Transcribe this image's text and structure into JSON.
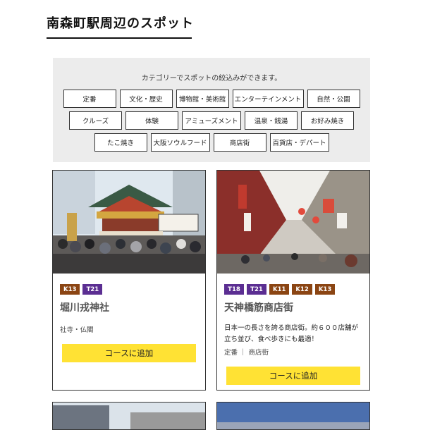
{
  "page": {
    "title": "南森町駅周辺のスポット"
  },
  "filter": {
    "caption": "カテゴリーでスポットの絞込みができます。",
    "row1": [
      "定番",
      "文化・歴史",
      "博物館・美術館",
      "エンターテインメント",
      "自然・公園"
    ],
    "row2": [
      "クルーズ",
      "体験",
      "アミューズメント",
      "温泉・銭湯",
      "お好み焼き"
    ],
    "row3": [
      "たこ焼き",
      "大阪ソウルフード",
      "商店街",
      "百貨店・デパート"
    ]
  },
  "cards": [
    {
      "tags": [
        {
          "label": "K13",
          "color": "#8b4513"
        },
        {
          "label": "T21",
          "color": "#5b2e92"
        }
      ],
      "name": "堀川戎神社",
      "category": "社寺・仏閣",
      "button": "コースに追加"
    },
    {
      "tags": [
        {
          "label": "T18",
          "color": "#5b2e92"
        },
        {
          "label": "T21",
          "color": "#5b2e92"
        },
        {
          "label": "K11",
          "color": "#8b4513"
        },
        {
          "label": "K12",
          "color": "#8b4513"
        },
        {
          "label": "K13",
          "color": "#8b4513"
        }
      ],
      "name": "天神橋筋商店街",
      "description": "日本一の長さを誇る商店街。約６００店舗が立ち並び、食べ歩きにも最適！",
      "category": "定番 ｜ 商店街",
      "button": "コースに追加"
    }
  ],
  "colors": {
    "button": "#ffe234",
    "tag_purple": "#5b2e92",
    "tag_brown": "#8b4513",
    "filter_bg": "#ececec"
  }
}
